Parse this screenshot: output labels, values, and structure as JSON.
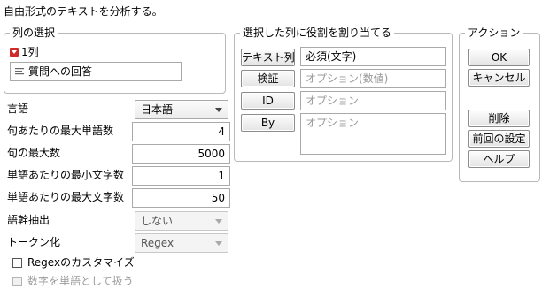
{
  "window": {
    "instruction": "自由形式のテキストを分析する。"
  },
  "column_select": {
    "title": "列の選択",
    "count_label": "1列",
    "items": [
      "質問への回答"
    ]
  },
  "roles": {
    "title": "選択した列に役割を割り当てる",
    "rows": [
      {
        "button": "テキスト列",
        "value": "必須(文字)",
        "is_placeholder": false
      },
      {
        "button": "検証",
        "value": "オプション(数値)",
        "is_placeholder": true
      },
      {
        "button": "ID",
        "value": "オプション",
        "is_placeholder": true
      },
      {
        "button": "By",
        "value": "オプション",
        "is_placeholder": true
      }
    ]
  },
  "actions": {
    "title": "アクション",
    "ok": "OK",
    "cancel": "キャンセル",
    "remove": "削除",
    "recall": "前回の設定",
    "help": "ヘルプ"
  },
  "options": {
    "language": {
      "label": "言語",
      "value": "日本語"
    },
    "max_words_per_phrase": {
      "label": "句あたりの最大単語数",
      "value": "4"
    },
    "max_phrases": {
      "label": "句の最大数",
      "value": "5000"
    },
    "min_chars_per_word": {
      "label": "単語あたりの最小文字数",
      "value": "1"
    },
    "max_chars_per_word": {
      "label": "単語あたりの最大文字数",
      "value": "50"
    },
    "stemming": {
      "label": "語幹抽出",
      "value": "しない"
    },
    "tokenizing": {
      "label": "トークン化",
      "value": "Regex"
    },
    "customize_regex": {
      "label": "Regexのカスタマイズ",
      "checked": false
    },
    "treat_numbers_as_words": {
      "label": "数字を単語として扱う",
      "checked": false,
      "disabled": true
    }
  }
}
